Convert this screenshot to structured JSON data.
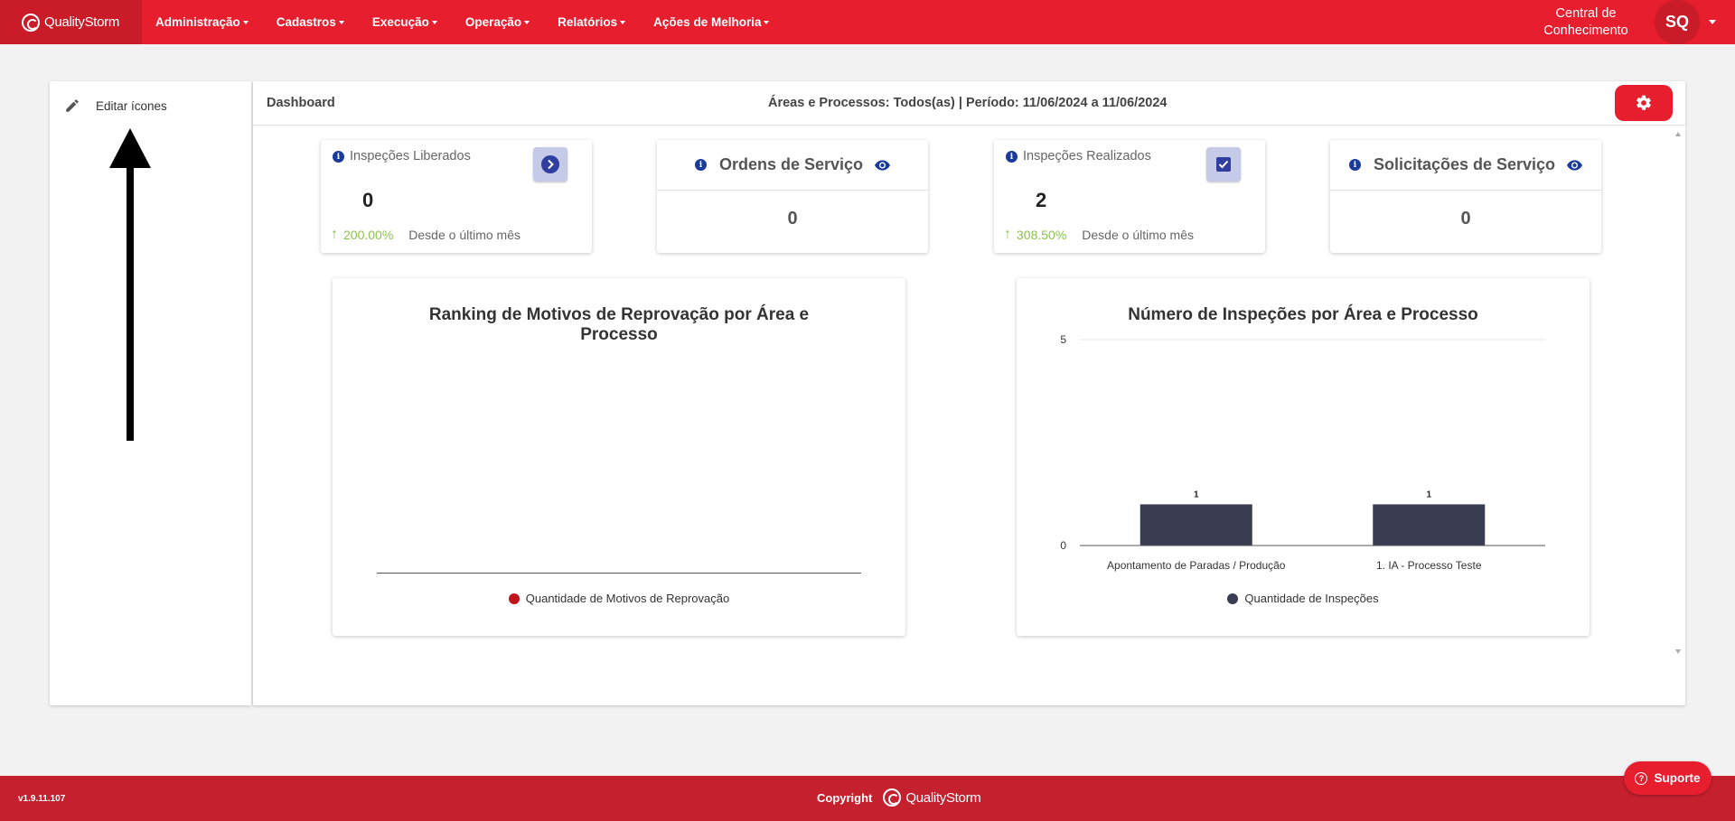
{
  "brand": {
    "name": "QualityStorm"
  },
  "nav": {
    "items": [
      {
        "label": "Administração"
      },
      {
        "label": "Cadastros"
      },
      {
        "label": "Execução"
      },
      {
        "label": "Operação"
      },
      {
        "label": "Relatórios"
      },
      {
        "label": "Ações de Melhoria"
      }
    ],
    "central_line1": "Central de",
    "central_line2": "Conhecimento",
    "avatar_initials": "SQ"
  },
  "sidebar": {
    "edit_icons_label": "Editar ícones"
  },
  "dashboard": {
    "title": "Dashboard",
    "filters": "Áreas e Processos:  Todos(as) | Período: 11/06/2024 a 11/06/2024",
    "kpis": {
      "inspecoes_liberados": {
        "label": "Inspeções Liberados",
        "value": "0",
        "pct": "200.00%",
        "since": "Desde o último mês"
      },
      "ordens_servico": {
        "label": "Ordens de Serviço",
        "value": "0"
      },
      "inspecoes_realizados": {
        "label": "Inspeções Realizados",
        "value": "2",
        "pct": "308.50%",
        "since": "Desde o último mês"
      },
      "solicitacoes_servico": {
        "label": "Solicitações de Serviço",
        "value": "0"
      }
    }
  },
  "chart_data": [
    {
      "type": "bar",
      "title_line1": "Ranking de Motivos de Reprovação por Área e",
      "title_line2": "Processo",
      "categories": [],
      "series": [
        {
          "name": "Quantidade de Motivos de Reprovação",
          "values": []
        }
      ],
      "legend_color": "#c0141c"
    },
    {
      "type": "bar",
      "title": "Número de Inspeções por Área e Processo",
      "categories": [
        "Apontamento de Paradas / Produção",
        "1. IA - Processo Teste"
      ],
      "series": [
        {
          "name": "Quantidade de Inspeções",
          "values": [
            1,
            1
          ]
        }
      ],
      "ylim": [
        0,
        5
      ],
      "yticks": [
        "5",
        "0"
      ],
      "bar_color": "#3a3d52"
    }
  ],
  "footer": {
    "version": "v1.9.11.107",
    "copyright": "Copyright",
    "brand": "QualityStorm",
    "support_label": "Suporte"
  },
  "colors": {
    "primary": "#e61e2e",
    "dark_red": "#c91b28",
    "info": "#1a3b9c",
    "trend": "#8bc34a"
  }
}
